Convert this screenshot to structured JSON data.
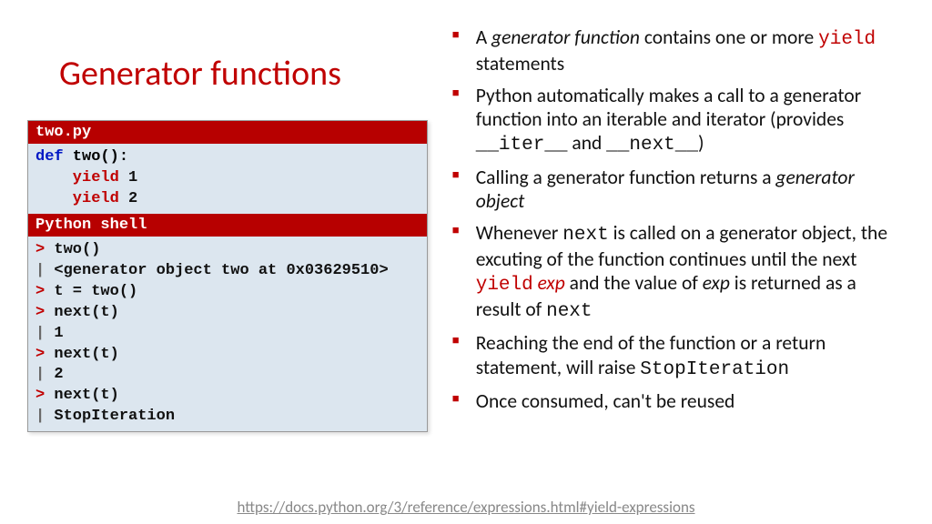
{
  "title": "Generator functions",
  "code1": {
    "header": "two.py",
    "l1_def": "def",
    "l1_rest": " two():",
    "l2_yield": "    yield",
    "l2_rest": " 1",
    "l3_yield": "    yield",
    "l3_rest": " 2"
  },
  "code2": {
    "header": "Python shell",
    "p1": ">",
    "l1": " two()",
    "p2": "|",
    "l2": " <generator object two at 0x03629510>",
    "p3": ">",
    "l3": " t = two()",
    "p4": ">",
    "l4": " next(t)",
    "p5": "|",
    "l5": " 1",
    "p6": ">",
    "l6": " next(t)",
    "p7": "|",
    "l7": " 2",
    "p8": ">",
    "l8": " next(t)",
    "p9": "|",
    "l9": " StopIteration"
  },
  "bullets": {
    "b1_a": "A ",
    "b1_b": "generator function",
    "b1_c": " contains one or more ",
    "b1_d": "yield",
    "b1_e": " statements",
    "b2_a": "Python automatically makes a call to a generator function into an iterable and iterator (provides ",
    "b2_b": "__iter__",
    "b2_c": " and ",
    "b2_d": "__next__",
    "b2_e": ")",
    "b3_a": "Calling a generator function returns a ",
    "b3_b": "generator object",
    "b4_a": "Whenever ",
    "b4_b": "next",
    "b4_c": " is called on a generator object, the excuting of the function continues until the next ",
    "b4_d": "yield",
    "b4_e": " ",
    "b4_f": "exp",
    "b4_g": " and the value of ",
    "b4_h": "exp",
    "b4_i": " is returned as a result of ",
    "b4_j": "next",
    "b5_a": "Reaching the end of the function or a return statement, will raise ",
    "b5_b": "StopIteration",
    "b6": "Once consumed, can't be reused"
  },
  "footer": "https://docs.python.org/3/reference/expressions.html#yield-expressions"
}
